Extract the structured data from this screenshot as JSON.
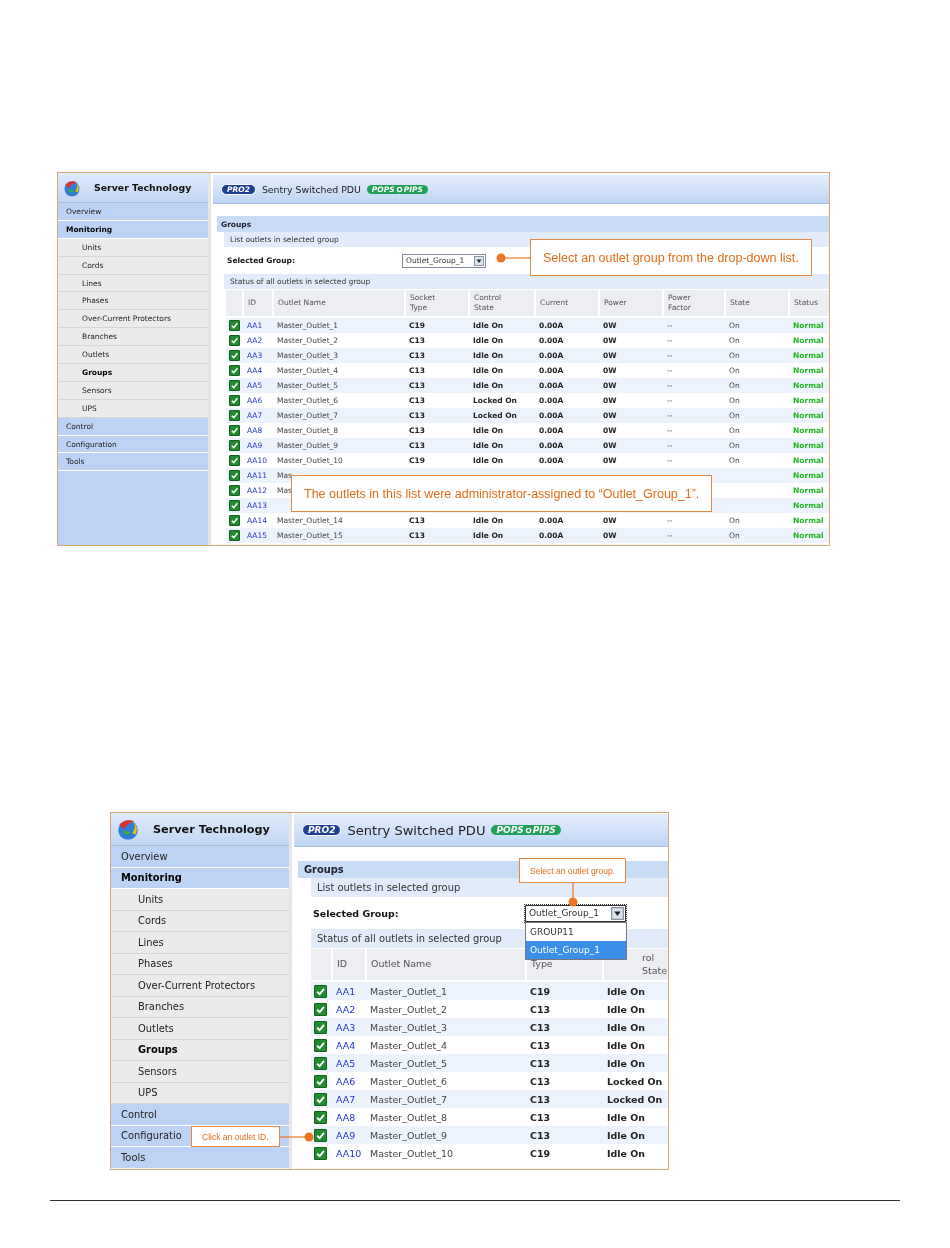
{
  "screens": [
    {
      "brand": "Server Technology",
      "banner": {
        "badge": "PRO2",
        "product": "Sentry Switched PDU",
        "logo_left": "POPS",
        "logo_right": "PIPS"
      },
      "sidebar": [
        {
          "label": "Overview",
          "kind": "section",
          "selected": false
        },
        {
          "label": "Monitoring",
          "kind": "section",
          "selected": true
        },
        {
          "label": "Units",
          "kind": "sub",
          "selected": false
        },
        {
          "label": "Cords",
          "kind": "sub",
          "selected": false
        },
        {
          "label": "Lines",
          "kind": "sub",
          "selected": false
        },
        {
          "label": "Phases",
          "kind": "sub",
          "selected": false
        },
        {
          "label": "Over-Current Protectors",
          "kind": "sub",
          "selected": false
        },
        {
          "label": "Branches",
          "kind": "sub",
          "selected": false
        },
        {
          "label": "Outlets",
          "kind": "sub",
          "selected": false
        },
        {
          "label": "Groups",
          "kind": "sub",
          "selected": true
        },
        {
          "label": "Sensors",
          "kind": "sub",
          "selected": false
        },
        {
          "label": "UPS",
          "kind": "sub",
          "selected": false
        },
        {
          "label": "Control",
          "kind": "section",
          "selected": false
        },
        {
          "label": "Configuration",
          "kind": "section",
          "selected": false
        },
        {
          "label": "Tools",
          "kind": "section",
          "selected": false
        }
      ],
      "section_title": "Groups",
      "list_title": "List outlets in selected group",
      "select_label": "Selected Group:",
      "select": {
        "value": "Outlet_Group_1",
        "expanded": false
      },
      "status_title": "Status of all outlets in selected group",
      "columns": [
        {
          "kind": "check"
        },
        {
          "kind": "link",
          "label": [
            "ID"
          ]
        },
        {
          "kind": "text",
          "label": [
            "Outlet Name"
          ]
        },
        {
          "kind": "strong",
          "label": [
            "Socket",
            "Type"
          ]
        },
        {
          "kind": "strong",
          "label": [
            "Control",
            "State"
          ]
        },
        {
          "kind": "strong",
          "label": [
            "Current"
          ]
        },
        {
          "kind": "strong",
          "label": [
            "Power"
          ]
        },
        {
          "kind": "text",
          "label": [
            "Power",
            "Factor"
          ]
        },
        {
          "kind": "text",
          "label": [
            "State"
          ]
        },
        {
          "kind": "status",
          "label": [
            "Status"
          ]
        }
      ],
      "rows": [
        {
          "checked": true,
          "id": "AA1",
          "name": "Master_Outlet_1",
          "socket": "C19",
          "control": "Idle On",
          "current": "0.00A",
          "power": "0W",
          "pf": "--",
          "state": "On",
          "status": "Normal"
        },
        {
          "checked": true,
          "id": "AA2",
          "name": "Master_Outlet_2",
          "socket": "C13",
          "control": "Idle On",
          "current": "0.00A",
          "power": "0W",
          "pf": "--",
          "state": "On",
          "status": "Normal"
        },
        {
          "checked": true,
          "id": "AA3",
          "name": "Master_Outlet_3",
          "socket": "C13",
          "control": "Idle On",
          "current": "0.00A",
          "power": "0W",
          "pf": "--",
          "state": "On",
          "status": "Normal"
        },
        {
          "checked": true,
          "id": "AA4",
          "name": "Master_Outlet_4",
          "socket": "C13",
          "control": "Idle On",
          "current": "0.00A",
          "power": "0W",
          "pf": "--",
          "state": "On",
          "status": "Normal"
        },
        {
          "checked": true,
          "id": "AA5",
          "name": "Master_Outlet_5",
          "socket": "C13",
          "control": "Idle On",
          "current": "0.00A",
          "power": "0W",
          "pf": "--",
          "state": "On",
          "status": "Normal"
        },
        {
          "checked": true,
          "id": "AA6",
          "name": "Master_Outlet_6",
          "socket": "C13",
          "control": "Locked On",
          "current": "0.00A",
          "power": "0W",
          "pf": "--",
          "state": "On",
          "status": "Normal"
        },
        {
          "checked": true,
          "id": "AA7",
          "name": "Master_Outlet_7",
          "socket": "C13",
          "control": "Locked On",
          "current": "0.00A",
          "power": "0W",
          "pf": "--",
          "state": "On",
          "status": "Normal"
        },
        {
          "checked": true,
          "id": "AA8",
          "name": "Master_Outlet_8",
          "socket": "C13",
          "control": "Idle On",
          "current": "0.00A",
          "power": "0W",
          "pf": "--",
          "state": "On",
          "status": "Normal"
        },
        {
          "checked": true,
          "id": "AA9",
          "name": "Master_Outlet_9",
          "socket": "C13",
          "control": "Idle On",
          "current": "0.00A",
          "power": "0W",
          "pf": "--",
          "state": "On",
          "status": "Normal"
        },
        {
          "checked": true,
          "id": "AA10",
          "name": "Master_Outlet_10",
          "socket": "C19",
          "control": "Idle On",
          "current": "0.00A",
          "power": "0W",
          "pf": "--",
          "state": "On",
          "status": "Normal"
        },
        {
          "checked": true,
          "id": "AA11",
          "name": "Mas",
          "status": "Normal"
        },
        {
          "checked": true,
          "id": "AA12",
          "name": "Mas",
          "status": "Normal"
        },
        {
          "checked": true,
          "id": "AA13",
          "status": "Normal"
        },
        {
          "checked": true,
          "id": "AA14",
          "name": "Master_Outlet_14",
          "socket": "C13",
          "control": "Idle On",
          "current": "0.00A",
          "power": "0W",
          "pf": "--",
          "state": "On",
          "status": "Normal"
        },
        {
          "checked": true,
          "id": "AA15",
          "name": "Master_Outlet_15",
          "socket": "C13",
          "control": "Idle On",
          "current": "0.00A",
          "power": "0W",
          "pf": "--",
          "state": "On",
          "status": "Normal"
        }
      ],
      "callouts": [
        {
          "text": "Select an outlet group from the drop-down list.",
          "kind": "left"
        },
        {
          "text": "The outlets in this list were administrator-assigned to “Outlet_Group_1”.",
          "kind": "plain"
        }
      ]
    },
    {
      "brand": "Server Technology",
      "banner": {
        "badge": "PRO2",
        "product": "Sentry Switched PDU",
        "logo_left": "POPS",
        "logo_right": "PIPS"
      },
      "sidebar": [
        {
          "label": "Overview",
          "kind": "section",
          "selected": false
        },
        {
          "label": "Monitoring",
          "kind": "section",
          "selected": true
        },
        {
          "label": "Units",
          "kind": "sub",
          "selected": false
        },
        {
          "label": "Cords",
          "kind": "sub",
          "selected": false
        },
        {
          "label": "Lines",
          "kind": "sub",
          "selected": false
        },
        {
          "label": "Phases",
          "kind": "sub",
          "selected": false
        },
        {
          "label": "Over-Current Protectors",
          "kind": "sub",
          "selected": false
        },
        {
          "label": "Branches",
          "kind": "sub",
          "selected": false
        },
        {
          "label": "Outlets",
          "kind": "sub",
          "selected": false
        },
        {
          "label": "Groups",
          "kind": "sub",
          "selected": true
        },
        {
          "label": "Sensors",
          "kind": "sub",
          "selected": false
        },
        {
          "label": "UPS",
          "kind": "sub",
          "selected": false
        },
        {
          "label": "Control",
          "kind": "section",
          "selected": false
        },
        {
          "label": "Configuratio",
          "kind": "section",
          "selected": false
        },
        {
          "label": "Tools",
          "kind": "section",
          "selected": false
        }
      ],
      "section_title": "Groups",
      "list_title": "List outlets in selected group",
      "select_label": "Selected Group:",
      "select": {
        "value": "Outlet_Group_1",
        "expanded": true,
        "options": [
          {
            "label": "GROUP11",
            "selected": false
          },
          {
            "label": "Outlet_Group_1",
            "selected": true
          }
        ]
      },
      "status_title": "Status of all outlets in selected group",
      "columns": [
        {
          "kind": "check"
        },
        {
          "kind": "link",
          "label": [
            "ID"
          ]
        },
        {
          "kind": "text",
          "label": [
            "Outlet Name"
          ]
        },
        {
          "kind": "strong",
          "label": [
            "Type"
          ]
        },
        {
          "kind": "strong",
          "label": [
            "rol",
            "State"
          ]
        }
      ],
      "rows": [
        {
          "checked": true,
          "id": "AA1",
          "name": "Master_Outlet_1",
          "socket": "C19",
          "control": "Idle On"
        },
        {
          "checked": true,
          "id": "AA2",
          "name": "Master_Outlet_2",
          "socket": "C13",
          "control": "Idle On"
        },
        {
          "checked": true,
          "id": "AA3",
          "name": "Master_Outlet_3",
          "socket": "C13",
          "control": "Idle On"
        },
        {
          "checked": true,
          "id": "AA4",
          "name": "Master_Outlet_4",
          "socket": "C13",
          "control": "Idle On"
        },
        {
          "checked": true,
          "id": "AA5",
          "name": "Master_Outlet_5",
          "socket": "C13",
          "control": "Idle On"
        },
        {
          "checked": true,
          "id": "AA6",
          "name": "Master_Outlet_6",
          "socket": "C13",
          "control": "Locked On"
        },
        {
          "checked": true,
          "id": "AA7",
          "name": "Master_Outlet_7",
          "socket": "C13",
          "control": "Locked On"
        },
        {
          "checked": true,
          "id": "AA8",
          "name": "Master_Outlet_8",
          "socket": "C13",
          "control": "Idle On"
        },
        {
          "checked": true,
          "id": "AA9",
          "name": "Master_Outlet_9",
          "socket": "C13",
          "control": "Idle On"
        },
        {
          "checked": true,
          "id": "AA10",
          "name": "Master_Outlet_10",
          "socket": "C19",
          "control": "Idle On"
        }
      ],
      "callouts": [
        {
          "text": "Select an outlet group.",
          "kind": "down"
        },
        {
          "text": "Click an outlet ID.",
          "kind": "right"
        }
      ]
    }
  ]
}
